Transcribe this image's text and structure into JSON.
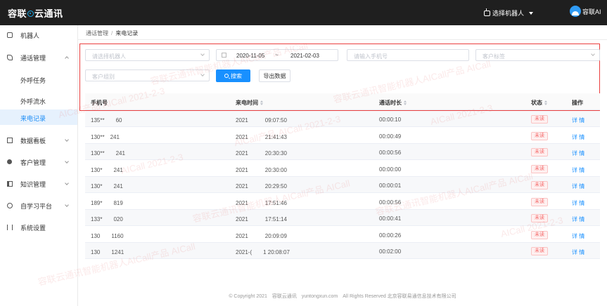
{
  "app": {
    "logo_text_left": "容联",
    "logo_text_right": "云通讯"
  },
  "header": {
    "robot_select_label": "选择机器人",
    "user_name": "容联AI"
  },
  "sidebar": {
    "items": [
      {
        "label": "机器人",
        "icon": "robot-icon"
      },
      {
        "label": "通话管理",
        "icon": "phone-icon",
        "expanded": true
      },
      {
        "label": "外呼任务"
      },
      {
        "label": "外呼流水"
      },
      {
        "label": "来电记录",
        "active": true
      },
      {
        "label": "数据看板",
        "icon": "chart-board-icon"
      },
      {
        "label": "客户管理",
        "icon": "users-icon"
      },
      {
        "label": "知识管理",
        "icon": "book-icon"
      },
      {
        "label": "自学习平台",
        "icon": "study-icon"
      },
      {
        "label": "系统设置",
        "icon": "settings-icon"
      }
    ]
  },
  "breadcrumb": {
    "parent": "通话管理",
    "separator": "/",
    "current": "来电记录"
  },
  "filters": {
    "robot_placeholder": "请选择机器人",
    "date_start": "2020-11-05",
    "date_sep": "~",
    "date_end": "2021-02-03",
    "phone_placeholder": "请输入手机号",
    "customer_tag_placeholder": "客户标签",
    "customer_group_placeholder": "客户组别",
    "search_label": "搜索",
    "export_label": "导出数据"
  },
  "table": {
    "headers": [
      "手机号",
      "来电时间",
      "通话时长",
      "状态",
      "操作"
    ],
    "rows": [
      {
        "phone": "135**　　60",
        "time": "2021　　　09:07:50",
        "duration": "00:00:10",
        "status": "未读",
        "action": "详 情"
      },
      {
        "phone": "130**　241",
        "time": "2021　　　21:41:43",
        "duration": "00:00:49",
        "status": "未读",
        "action": "详 情"
      },
      {
        "phone": "130**　　241",
        "time": "2021　　　20:30:30",
        "duration": "00:00:56",
        "status": "未读",
        "action": "详 情"
      },
      {
        "phone": "130*　　241",
        "time": "2021　　　20:30:00",
        "duration": "00:00:00",
        "status": "未读",
        "action": "详 情"
      },
      {
        "phone": "130*　　241",
        "time": "2021　　　20:29:50",
        "duration": "00:00:01",
        "status": "未读",
        "action": "详 情"
      },
      {
        "phone": "189*　　819",
        "time": "2021　　　17:51:46",
        "duration": "00:00:56",
        "status": "未读",
        "action": "详 情"
      },
      {
        "phone": "133*　　020",
        "time": "2021　　　17:51:14",
        "duration": "00:00:41",
        "status": "未读",
        "action": "详 情"
      },
      {
        "phone": "130　　1160",
        "time": "2021　　　20:09:09",
        "duration": "00:00:26",
        "status": "未读",
        "action": "详 情"
      },
      {
        "phone": "130　　1241",
        "time": "2021-(　　1 20:08:07",
        "duration": "00:02:00",
        "status": "未读",
        "action": "详 情"
      }
    ]
  },
  "footer": "© Copyright 2021　容联云通讯　yuntongxun.com　All Rights Reserved 北京容联易通信息技术有限公司",
  "watermark": {
    "line_a": "容联云通讯智能机器人AICall产品 AICall",
    "line_b": "AICall产品 AICall 2021-2-3",
    "line_c": "AICall 2021-2-3"
  },
  "colors": {
    "accent": "#1890ff",
    "highlight_frame": "#ea3f3f",
    "status_unread": "#f56c6c",
    "topbar": "#1f1f1f"
  }
}
